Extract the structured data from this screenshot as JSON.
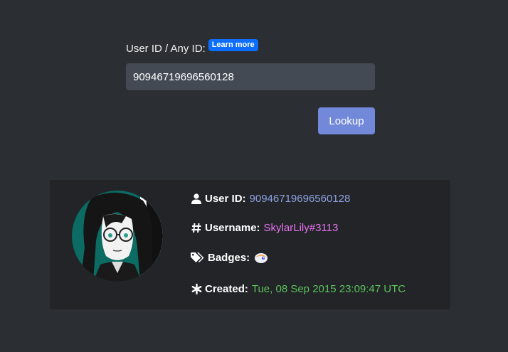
{
  "form": {
    "label": "User ID / Any ID:",
    "learn_more": "Learn more",
    "input_value": "90946719696560128",
    "lookup_label": "Lookup"
  },
  "result": {
    "user_id_label": "User ID:",
    "user_id_value": "90946719696560128",
    "username_label": "Username:",
    "username_value": "SkylarLily#3113",
    "badges_label": "Badges:",
    "badges": [
      "hypesquad-badge-icon"
    ],
    "created_label": "Created:",
    "created_value": "Tue, 08 Sep 2015 23:09:47 UTC"
  },
  "colors": {
    "background": "#2b2e33",
    "card": "#222427",
    "accent_button": "#7289da",
    "learn_more_badge": "#0d6efd",
    "user_id_value": "#8ea1e1",
    "username_value": "#e673f0",
    "created_value": "#5cc25c"
  }
}
